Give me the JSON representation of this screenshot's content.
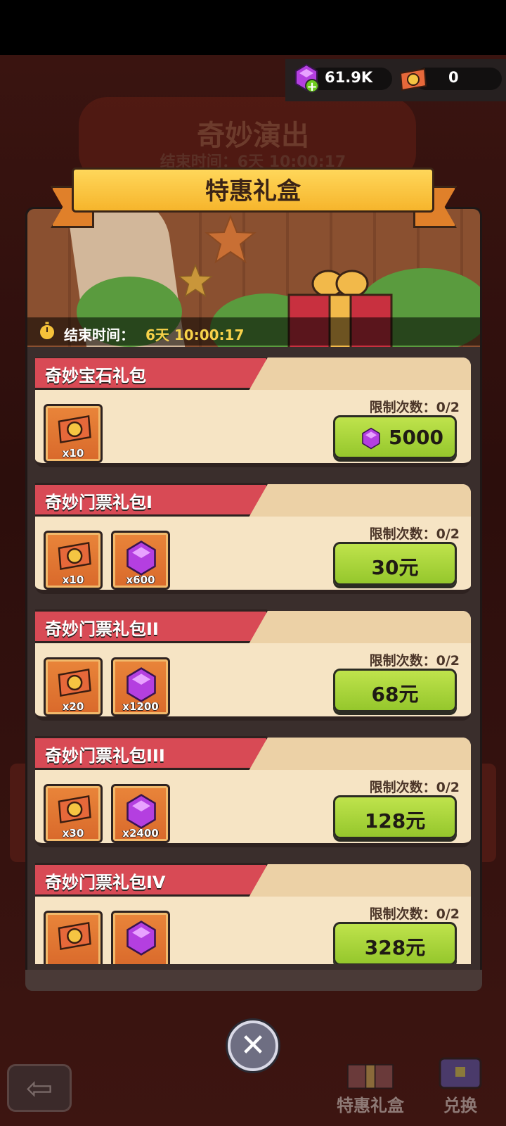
{
  "currency": {
    "gems": "61.9K",
    "tickets": "0"
  },
  "background": {
    "event_title": "奇妙演出",
    "event_timer": "结束时间：6天 10:00:17"
  },
  "modal": {
    "title": "特惠礼盒",
    "ends_label": "结束时间：",
    "ends_value": "6天 10:00:17"
  },
  "packs": [
    {
      "title": "奇妙宝石礼包",
      "limit": "限制次数：0/2",
      "price": "5000",
      "price_type": "gem",
      "items": [
        {
          "icon": "ticket-icon",
          "qty": "x10"
        }
      ]
    },
    {
      "title": "奇妙门票礼包I",
      "limit": "限制次数：0/2",
      "price": "30元",
      "price_type": "cash",
      "items": [
        {
          "icon": "ticket-icon",
          "qty": "x10"
        },
        {
          "icon": "gem-icon",
          "qty": "x600"
        }
      ]
    },
    {
      "title": "奇妙门票礼包II",
      "limit": "限制次数：0/2",
      "price": "68元",
      "price_type": "cash",
      "items": [
        {
          "icon": "ticket-icon",
          "qty": "x20"
        },
        {
          "icon": "gem-icon",
          "qty": "x1200"
        }
      ]
    },
    {
      "title": "奇妙门票礼包III",
      "limit": "限制次数：0/2",
      "price": "128元",
      "price_type": "cash",
      "items": [
        {
          "icon": "ticket-icon",
          "qty": "x30"
        },
        {
          "icon": "gem-icon",
          "qty": "x2400"
        }
      ]
    },
    {
      "title": "奇妙门票礼包IV",
      "limit": "限制次数：0/2",
      "price": "328元",
      "price_type": "cash",
      "items": [
        {
          "icon": "ticket-icon",
          "qty": ""
        },
        {
          "icon": "gem-icon",
          "qty": ""
        }
      ]
    }
  ],
  "nav": {
    "gift_box": "特惠礼盒",
    "exchange": "兑换"
  },
  "colors": {
    "buy_button": "#a6d23a",
    "pack_tag": "#d84a55",
    "ribbon": "#f6b52c",
    "timer_value": "#f7d24a"
  }
}
